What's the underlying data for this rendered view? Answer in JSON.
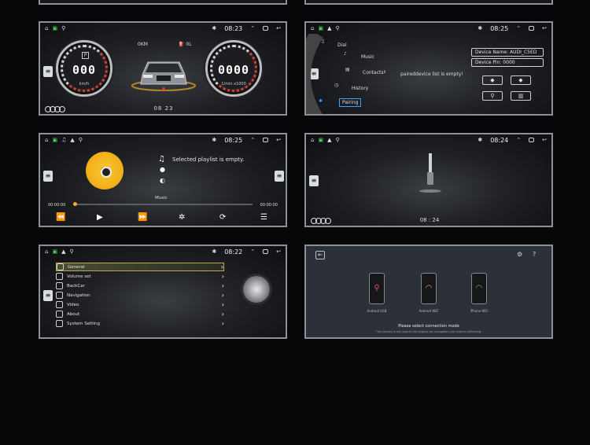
{
  "common": {
    "icons": {
      "home": "home-icon",
      "bluetooth": "bluetooth-icon",
      "usb": "usb-icon",
      "window": "window-icon",
      "back": "back-icon",
      "up": "chevron-up-icon"
    }
  },
  "dashboard": {
    "time": "08:23",
    "speed_value": "000",
    "speed_unit": "km/h",
    "rpm_value": "0000",
    "rpm_unit": "1/min x1000",
    "gear": "P",
    "odometer": "0KM",
    "fuel": "0L",
    "clock": "08  23"
  },
  "phone": {
    "time": "08:25",
    "menu": [
      "Dial",
      "Music",
      "Contacts",
      "History"
    ],
    "pairing_label": "Pairing",
    "empty_text": "paireddevice list is empty!",
    "device_name": "Device Name:  AUDI_C5ED",
    "device_pin": "Device Pin:  0000"
  },
  "music": {
    "time": "08:25",
    "empty_text": "Selected playlist is empty.",
    "label": "Music",
    "time_start": "00:00:00",
    "time_end": "00:00:00"
  },
  "aux": {
    "time": "08:24",
    "clock": "08 : 24"
  },
  "settings": {
    "time": "08:22",
    "items": [
      "General",
      "Volume set",
      "BackCar",
      "Navigation",
      "Video",
      "About",
      "System Setting"
    ]
  },
  "mode": {
    "phones": [
      {
        "label": "Android USB",
        "color": "#e24a8a"
      },
      {
        "label": "Android WiFi",
        "color": "#f0b32a"
      },
      {
        "label": "iPhone WiFi",
        "color": "#3fd16a"
      }
    ],
    "title": "Please select connection mode",
    "subtitle": "This version is not used in the original car navigation you need to reflashing."
  }
}
